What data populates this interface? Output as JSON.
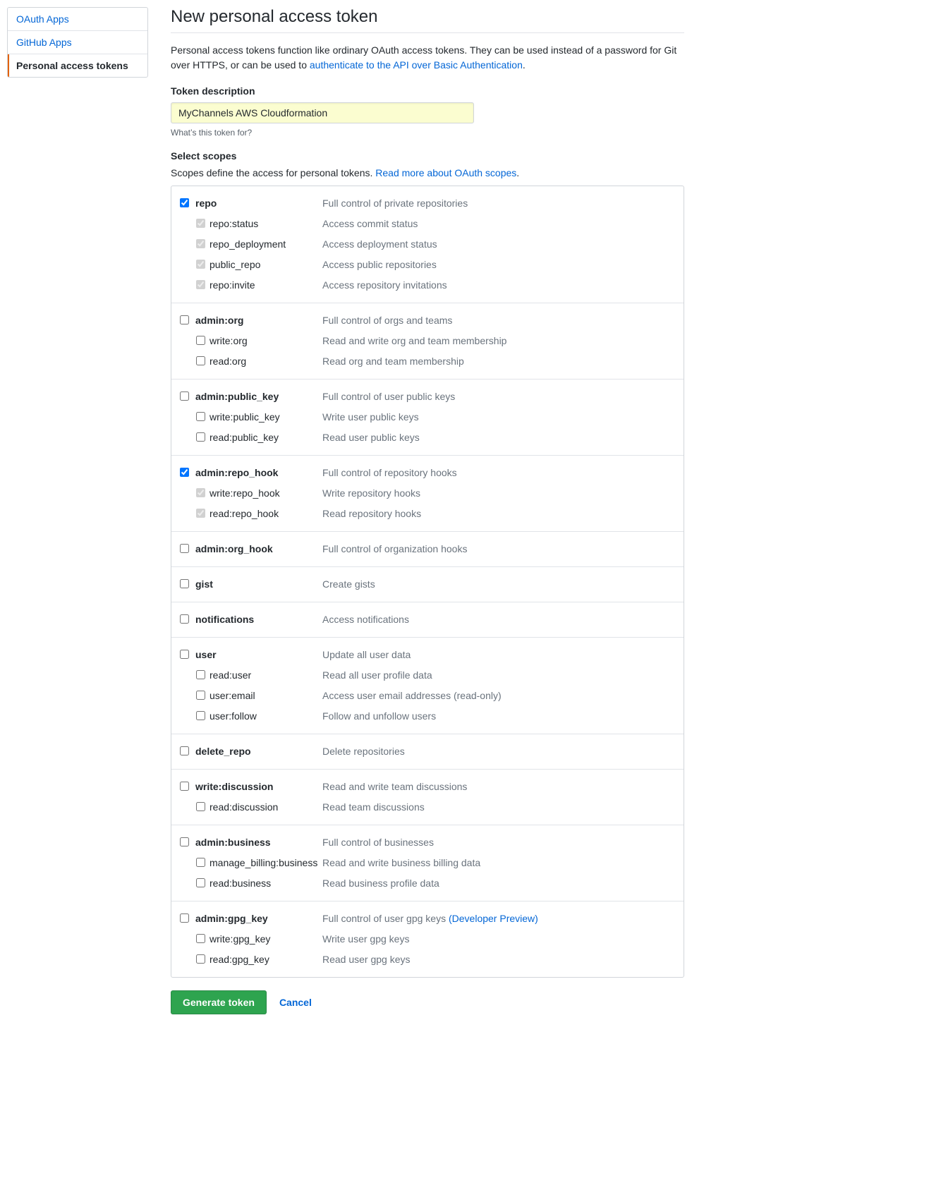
{
  "sidebar": {
    "items": [
      {
        "label": "OAuth Apps",
        "active": false
      },
      {
        "label": "GitHub Apps",
        "active": false
      },
      {
        "label": "Personal access tokens",
        "active": true
      }
    ]
  },
  "page": {
    "title": "New personal access token",
    "intro_before": "Personal access tokens function like ordinary OAuth access tokens. They can be used instead of a password for Git over HTTPS, or can be used to ",
    "intro_link": "authenticate to the API over Basic Authentication",
    "intro_after": "."
  },
  "token_description": {
    "label": "Token description",
    "value": "MyChannels AWS Cloudformation",
    "hint": "What’s this token for?"
  },
  "scopes_header": {
    "label": "Select scopes",
    "intro_before": "Scopes define the access for personal tokens. ",
    "intro_link": "Read more about OAuth scopes",
    "intro_after": "."
  },
  "scopes": [
    {
      "name": "repo",
      "desc": "Full control of private repositories",
      "checked": true,
      "children": [
        {
          "name": "repo:status",
          "desc": "Access commit status",
          "checked": true,
          "disabled": true
        },
        {
          "name": "repo_deployment",
          "desc": "Access deployment status",
          "checked": true,
          "disabled": true
        },
        {
          "name": "public_repo",
          "desc": "Access public repositories",
          "checked": true,
          "disabled": true
        },
        {
          "name": "repo:invite",
          "desc": "Access repository invitations",
          "checked": true,
          "disabled": true
        }
      ]
    },
    {
      "name": "admin:org",
      "desc": "Full control of orgs and teams",
      "checked": false,
      "children": [
        {
          "name": "write:org",
          "desc": "Read and write org and team membership",
          "checked": false
        },
        {
          "name": "read:org",
          "desc": "Read org and team membership",
          "checked": false
        }
      ]
    },
    {
      "name": "admin:public_key",
      "desc": "Full control of user public keys",
      "checked": false,
      "children": [
        {
          "name": "write:public_key",
          "desc": "Write user public keys",
          "checked": false
        },
        {
          "name": "read:public_key",
          "desc": "Read user public keys",
          "checked": false
        }
      ]
    },
    {
      "name": "admin:repo_hook",
      "desc": "Full control of repository hooks",
      "checked": true,
      "children": [
        {
          "name": "write:repo_hook",
          "desc": "Write repository hooks",
          "checked": true,
          "disabled": true
        },
        {
          "name": "read:repo_hook",
          "desc": "Read repository hooks",
          "checked": true,
          "disabled": true
        }
      ]
    },
    {
      "name": "admin:org_hook",
      "desc": "Full control of organization hooks",
      "checked": false,
      "children": []
    },
    {
      "name": "gist",
      "desc": "Create gists",
      "checked": false,
      "children": []
    },
    {
      "name": "notifications",
      "desc": "Access notifications",
      "checked": false,
      "children": []
    },
    {
      "name": "user",
      "desc": "Update all user data",
      "checked": false,
      "children": [
        {
          "name": "read:user",
          "desc": "Read all user profile data",
          "checked": false
        },
        {
          "name": "user:email",
          "desc": "Access user email addresses (read-only)",
          "checked": false
        },
        {
          "name": "user:follow",
          "desc": "Follow and unfollow users",
          "checked": false
        }
      ]
    },
    {
      "name": "delete_repo",
      "desc": "Delete repositories",
      "checked": false,
      "children": []
    },
    {
      "name": "write:discussion",
      "desc": "Read and write team discussions",
      "checked": false,
      "children": [
        {
          "name": "read:discussion",
          "desc": "Read team discussions",
          "checked": false
        }
      ]
    },
    {
      "name": "admin:business",
      "desc": "Full control of businesses",
      "checked": false,
      "children": [
        {
          "name": "manage_billing:business",
          "desc": "Read and write business billing data",
          "checked": false
        },
        {
          "name": "read:business",
          "desc": "Read business profile data",
          "checked": false
        }
      ]
    },
    {
      "name": "admin:gpg_key",
      "desc_before": "Full control of user gpg keys ",
      "desc_link": "(Developer Preview)",
      "checked": false,
      "children": [
        {
          "name": "write:gpg_key",
          "desc": "Write user gpg keys",
          "checked": false
        },
        {
          "name": "read:gpg_key",
          "desc": "Read user gpg keys",
          "checked": false
        }
      ]
    }
  ],
  "actions": {
    "generate": "Generate token",
    "cancel": "Cancel"
  }
}
